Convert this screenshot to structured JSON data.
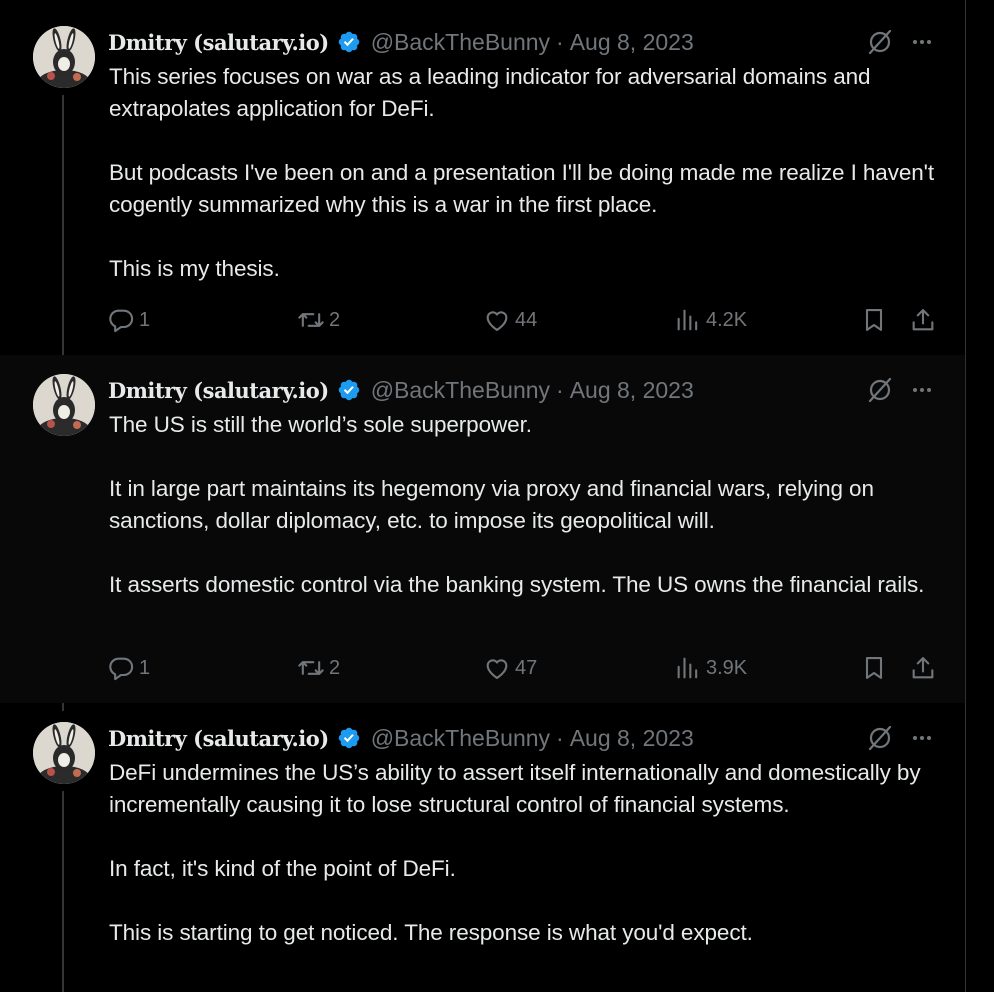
{
  "tweets": [
    {
      "author": {
        "name": "Dmitry (salutary.io)",
        "handle": "@BackTheBunny",
        "verified": true
      },
      "separator": "·",
      "date": "Aug 8, 2023",
      "paragraphs": [
        "This series focuses on war as a leading indicator for adversarial domains and extrapolates application for DeFi.",
        "But podcasts I've been on and a presentation I'll be doing made me realize I haven't cogently summarized why this is a war in the first place.",
        "This is my thesis."
      ],
      "stats": {
        "replies": "1",
        "retweets": "2",
        "likes": "44",
        "views": "4.2K"
      }
    },
    {
      "author": {
        "name": "Dmitry (salutary.io)",
        "handle": "@BackTheBunny",
        "verified": true
      },
      "separator": "·",
      "date": "Aug 8, 2023",
      "paragraphs": [
        "The US is still the world’s sole superpower.",
        "It in large part maintains its hegemony via proxy and financial wars, relying on sanctions, dollar diplomacy, etc. to impose its geopolitical will.",
        "It asserts domestic control via the banking system. The US owns the financial rails."
      ],
      "stats": {
        "replies": "1",
        "retweets": "2",
        "likes": "47",
        "views": "3.9K"
      }
    },
    {
      "author": {
        "name": "Dmitry (salutary.io)",
        "handle": "@BackTheBunny",
        "verified": true
      },
      "separator": "·",
      "date": "Aug 8, 2023",
      "paragraphs": [
        "DeFi undermines the US’s ability to assert itself internationally and domestically by incrementally causing it to lose structural control of financial systems.",
        "In fact, it's kind of the point of DeFi.",
        "This is starting to get noticed. The response is what you'd expect."
      ]
    }
  ],
  "icons": {
    "verified": "verified-badge-icon",
    "grok": "grok-icon",
    "more": "more-icon",
    "reply": "reply-icon",
    "retweet": "retweet-icon",
    "like": "heart-icon",
    "views": "views-icon",
    "bookmark": "bookmark-icon",
    "share": "share-icon"
  },
  "colors": {
    "background": "#000000",
    "highlighted_background": "#080808",
    "text": "#e7e9ea",
    "secondary_text": "#71767b",
    "verified_blue": "#1d9bf0",
    "thread_line": "#333639"
  }
}
